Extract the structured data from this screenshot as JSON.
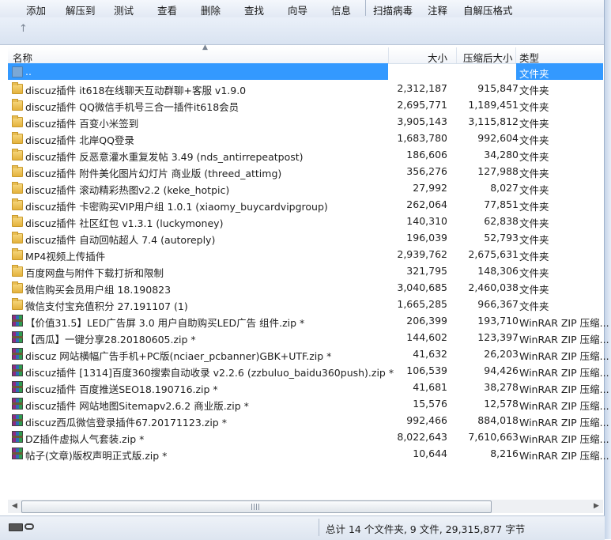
{
  "toolbar": {
    "buttons": [
      "添加",
      "解压到",
      "测试",
      "查看",
      "删除",
      "查找",
      "向导",
      "信息",
      "扫描病毒",
      "注释",
      "自解压格式"
    ]
  },
  "nav": {
    "up_icon": "up-arrow-icon"
  },
  "columns": {
    "name": "名称",
    "size": "大小",
    "packed": "压缩后大小",
    "type": "类型"
  },
  "rows": [
    {
      "name": "..",
      "size": "",
      "packed": "",
      "type": "文件夹",
      "icon": "parent-folder-icon",
      "selected": true
    },
    {
      "name": "discuz插件 it618在线聊天互动群聊+客服 v1.9.0",
      "size": "2,312,187",
      "packed": "915,847",
      "type": "文件夹",
      "icon": "folder-icon"
    },
    {
      "name": "discuz插件 QQ微信手机号三合一插件it618会员",
      "size": "2,695,771",
      "packed": "1,189,451",
      "type": "文件夹",
      "icon": "folder-icon"
    },
    {
      "name": "discuz插件 百变小米签到",
      "size": "3,905,143",
      "packed": "3,115,812",
      "type": "文件夹",
      "icon": "folder-icon"
    },
    {
      "name": "discuz插件 北岸QQ登录",
      "size": "1,683,780",
      "packed": "992,604",
      "type": "文件夹",
      "icon": "folder-icon"
    },
    {
      "name": "discuz插件 反恶意灌水重复发帖 3.49 (nds_antirrepeatpost)",
      "size": "186,606",
      "packed": "34,280",
      "type": "文件夹",
      "icon": "folder-icon"
    },
    {
      "name": "discuz插件 附件美化图片幻灯片 商业版 (threed_attimg)",
      "size": "356,276",
      "packed": "127,988",
      "type": "文件夹",
      "icon": "folder-icon"
    },
    {
      "name": "discuz插件 滚动精彩热图v2.2 (keke_hotpic)",
      "size": "27,992",
      "packed": "8,027",
      "type": "文件夹",
      "icon": "folder-icon"
    },
    {
      "name": "discuz插件 卡密购买VIP用户组 1.0.1 (xiaomy_buycardvipgroup)",
      "size": "262,064",
      "packed": "77,851",
      "type": "文件夹",
      "icon": "folder-icon"
    },
    {
      "name": "discuz插件 社区红包 v1.3.1 (luckymoney)",
      "size": "140,310",
      "packed": "62,838",
      "type": "文件夹",
      "icon": "folder-icon"
    },
    {
      "name": "discuz插件 自动回帖超人 7.4 (autoreply)",
      "size": "196,039",
      "packed": "52,793",
      "type": "文件夹",
      "icon": "folder-icon"
    },
    {
      "name": "MP4视频上传插件",
      "size": "2,939,762",
      "packed": "2,675,631",
      "type": "文件夹",
      "icon": "folder-icon"
    },
    {
      "name": "百度网盘与附件下载打折和限制",
      "size": "321,795",
      "packed": "148,306",
      "type": "文件夹",
      "icon": "folder-icon"
    },
    {
      "name": "微信购买会员用户组 18.190823",
      "size": "3,040,685",
      "packed": "2,460,038",
      "type": "文件夹",
      "icon": "folder-icon"
    },
    {
      "name": "微信支付宝充值积分 27.191107 (1)",
      "size": "1,665,285",
      "packed": "966,367",
      "type": "文件夹",
      "icon": "folder-icon"
    },
    {
      "name": "【价值31.5】LED广告屏 3.0 用户自助购买LED广告 组件.zip *",
      "size": "206,399",
      "packed": "193,710",
      "type": "WinRAR ZIP 压缩...",
      "icon": "winrar-zip-icon"
    },
    {
      "name": "【西瓜】一键分享28.20180605.zip *",
      "size": "144,602",
      "packed": "123,397",
      "type": "WinRAR ZIP 压缩...",
      "icon": "winrar-zip-icon"
    },
    {
      "name": "discuz 网站横幅广告手机+PC版(nciaer_pcbanner)GBK+UTF.zip *",
      "size": "41,632",
      "packed": "26,203",
      "type": "WinRAR ZIP 压缩...",
      "icon": "winrar-zip-icon"
    },
    {
      "name": "discuz插件 [1314]百度360搜索自动收录 v2.2.6 (zzbuluo_baidu360push).zip *",
      "size": "106,539",
      "packed": "94,426",
      "type": "WinRAR ZIP 压缩...",
      "icon": "winrar-zip-icon"
    },
    {
      "name": "discuz插件 百度推送SEO18.190716.zip *",
      "size": "41,681",
      "packed": "38,278",
      "type": "WinRAR ZIP 压缩...",
      "icon": "winrar-zip-icon"
    },
    {
      "name": "discuz插件 网站地图Sitemapv2.6.2 商业版.zip *",
      "size": "15,576",
      "packed": "12,578",
      "type": "WinRAR ZIP 压缩...",
      "icon": "winrar-zip-icon"
    },
    {
      "name": "discuz西瓜微信登录插件67.20171123.zip *",
      "size": "992,466",
      "packed": "884,018",
      "type": "WinRAR ZIP 压缩...",
      "icon": "winrar-zip-icon"
    },
    {
      "name": "DZ插件虚拟人气套装.zip *",
      "size": "8,022,643",
      "packed": "7,610,663",
      "type": "WinRAR ZIP 压缩...",
      "icon": "winrar-zip-icon"
    },
    {
      "name": "帖子(文章)版权声明正式版.zip *",
      "size": "10,644",
      "packed": "8,216",
      "type": "WinRAR ZIP 压缩...",
      "icon": "winrar-zip-icon"
    }
  ],
  "status": {
    "summary": "总计 14 个文件夹, 9 文件, 29,315,877 字节"
  }
}
